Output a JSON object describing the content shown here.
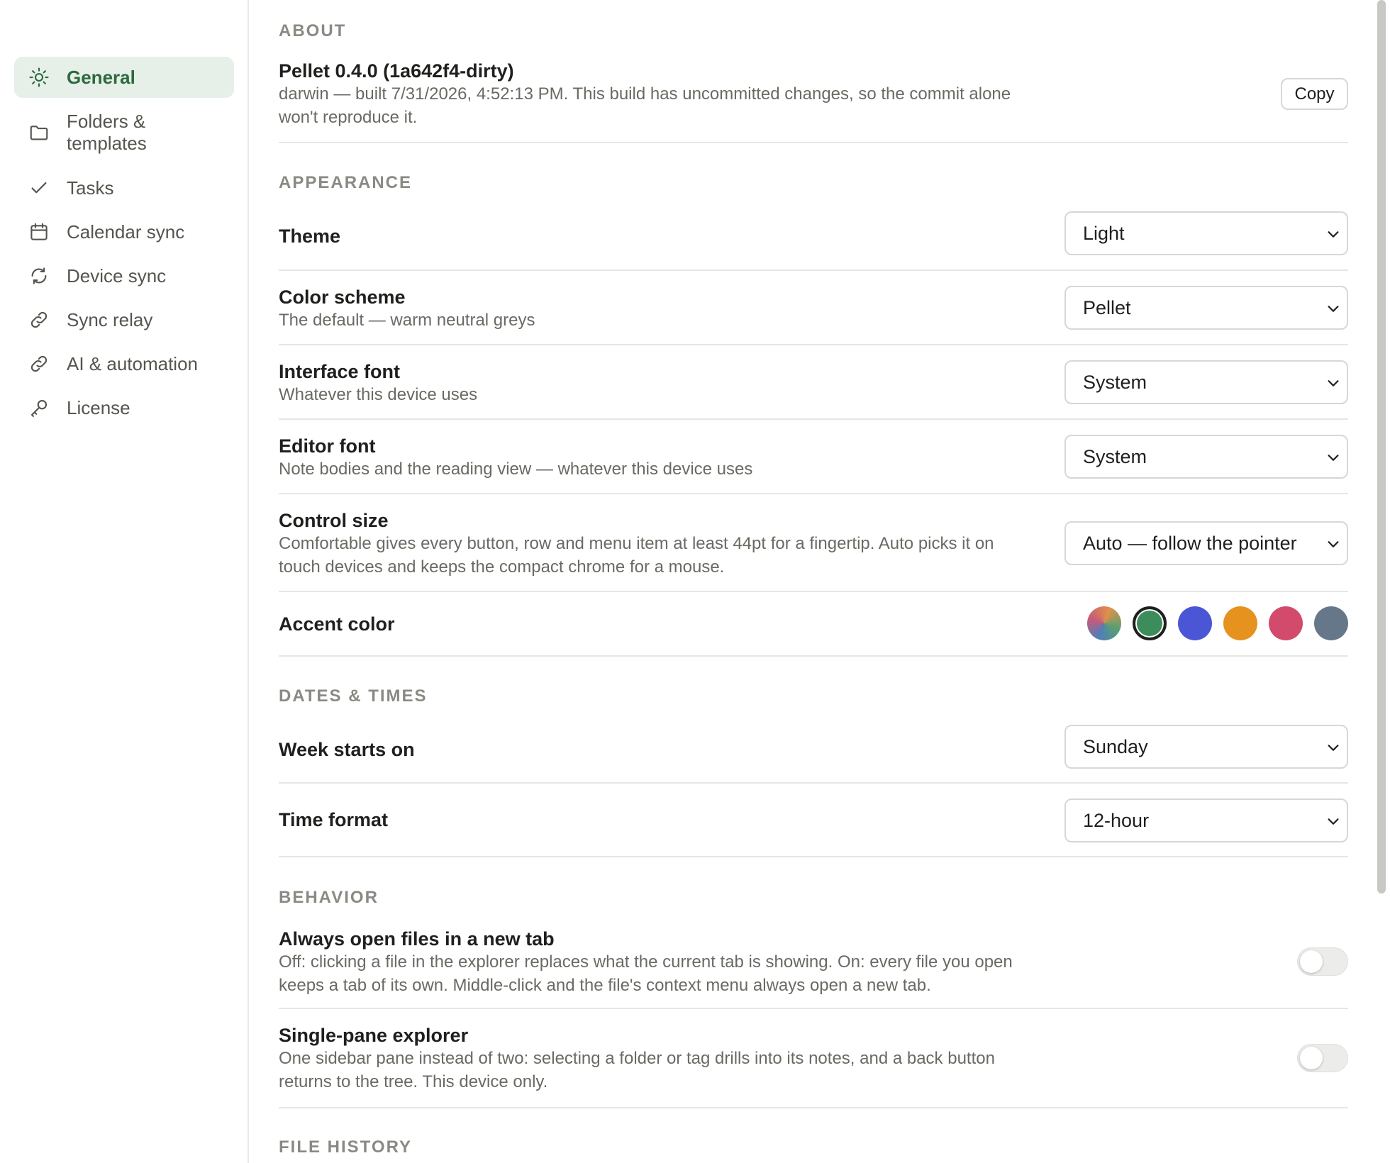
{
  "sidebar": {
    "items": [
      {
        "label": "General",
        "icon": "sun-icon"
      },
      {
        "label": "Folders & templates",
        "icon": "folder-icon"
      },
      {
        "label": "Tasks",
        "icon": "check-icon"
      },
      {
        "label": "Calendar sync",
        "icon": "calendar-icon"
      },
      {
        "label": "Device sync",
        "icon": "sync-icon"
      },
      {
        "label": "Sync relay",
        "icon": "link-icon"
      },
      {
        "label": "AI & automation",
        "icon": "link-icon"
      },
      {
        "label": "License",
        "icon": "key-icon"
      }
    ],
    "folders_line1": "Folders &",
    "folders_line2": "templates"
  },
  "about": {
    "section": "ABOUT",
    "title": "Pellet 0.4.0 (1a642f4-dirty)",
    "desc": "darwin — built 7/31/2026, 4:52:13 PM. This build has uncommitted changes, so the commit alone won't reproduce it.",
    "copy_label": "Copy"
  },
  "appearance": {
    "section": "APPEARANCE",
    "theme": {
      "title": "Theme",
      "value": "Light"
    },
    "color_scheme": {
      "title": "Color scheme",
      "desc": "The default — warm neutral greys",
      "value": "Pellet"
    },
    "interface_font": {
      "title": "Interface font",
      "desc": "Whatever this device uses",
      "value": "System"
    },
    "editor_font": {
      "title": "Editor font",
      "desc": "Note bodies and the reading view — whatever this device uses",
      "value": "System"
    },
    "control_size": {
      "title": "Control size",
      "desc": "Comfortable gives every button, row and menu item at least 44pt for a fingertip. Auto picks it on touch devices and keeps the compact chrome for a mouse.",
      "value": "Auto — follow the pointer"
    },
    "accent": {
      "title": "Accent color",
      "swatches": [
        "#5a7fa0",
        "#3d8c5c",
        "#4a56d6",
        "#e6921e",
        "#d24a6c",
        "#66778a"
      ],
      "selected_index": 1
    }
  },
  "dates": {
    "section": "DATES & TIMES",
    "week_start": {
      "title": "Week starts on",
      "value": "Sunday"
    },
    "time_format": {
      "title": "Time format",
      "value": "12-hour"
    }
  },
  "behavior": {
    "section": "BEHAVIOR",
    "new_tab": {
      "title": "Always open files in a new tab",
      "desc": "Off: clicking a file in the explorer replaces what the current tab is showing. On: every file you open keeps a tab of its own. Middle-click and the file's context menu always open a new tab.",
      "on": false
    },
    "single_pane": {
      "title": "Single-pane explorer",
      "desc": "One sidebar pane instead of two: selecting a folder or tag drills into its notes, and a back button returns to the tree. This device only.",
      "on": false
    }
  },
  "file_history": {
    "section": "FILE HISTORY"
  },
  "colors": {
    "accent": "#2d6a3e",
    "active_bg": "#e6efe8"
  }
}
